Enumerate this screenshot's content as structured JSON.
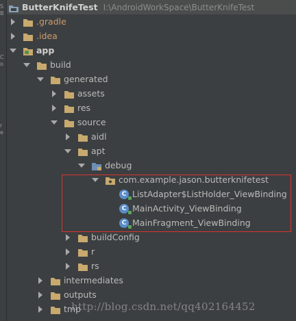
{
  "side_strip": {
    "chars": [
      "S",
      "B",
      "C",
      "o",
      "r",
      "e"
    ]
  },
  "project": {
    "name": "ButterKnifeTest",
    "path": "I:\\AndroidWorkSpace\\ButterKnifeTest"
  },
  "tree": {
    "gradle": ".gradle",
    "idea": ".idea",
    "app": "app",
    "build": "build",
    "generated": "generated",
    "assets": "assets",
    "res": "res",
    "source": "source",
    "aidl": "aidl",
    "apt": "apt",
    "debug": "debug",
    "package": "com.example.jason.butterknifetest",
    "classes": [
      "ListAdapter$ListHolder_ViewBinding",
      "MainActivity_ViewBinding",
      "MainFragment_ViewBinding"
    ],
    "buildConfig": "buildConfig",
    "r": "r",
    "rs": "rs",
    "intermediates": "intermediates",
    "outputs": "outputs",
    "tmp": "tmp"
  },
  "class_icon_letter": "C",
  "watermark": "http://blog.csdn.net/qq402164452",
  "colors": {
    "background": "#3c3f41",
    "text": "#bbbbbb",
    "excluded_text": "#d09b6c",
    "folder": "#c8a96e",
    "class_icon": "#5a8dc8",
    "highlight_box": "#d9352f"
  }
}
